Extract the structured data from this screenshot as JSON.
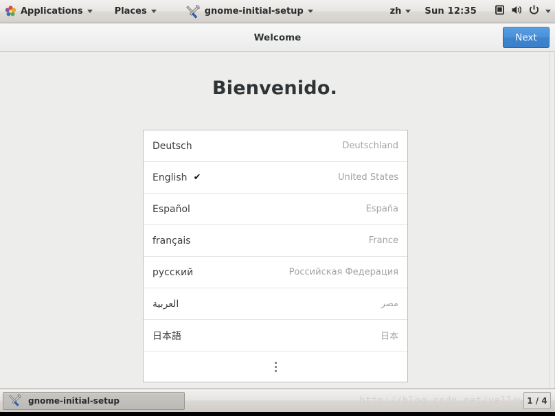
{
  "top_panel": {
    "applications_label": "Applications",
    "places_label": "Places",
    "window_menu_label": "gnome-initial-setup",
    "input_source_label": "zh",
    "clock_label": "Sun 12:35",
    "icons": {
      "applications": "fedora-pinwheel-icon",
      "window": "wrench-screwdriver-icon",
      "display": "display-icon",
      "volume": "speaker-icon",
      "power": "power-icon",
      "menu_arrow": "chevron-down-icon"
    }
  },
  "app_header": {
    "title": "Welcome",
    "next_label": "Next",
    "next_color": "#4a90d9"
  },
  "content": {
    "heading": "Bienvenido.",
    "languages": [
      {
        "name": "Deutsch",
        "region": "Deutschland",
        "selected": false,
        "rtl": false
      },
      {
        "name": "English",
        "region": "United States",
        "selected": true,
        "rtl": false
      },
      {
        "name": "Español",
        "region": "España",
        "selected": false,
        "rtl": false
      },
      {
        "name": "français",
        "region": "France",
        "selected": false,
        "rtl": false
      },
      {
        "name": "русский",
        "region": "Российская Федерация",
        "selected": false,
        "rtl": false
      },
      {
        "name": "العربية",
        "region": "مصر",
        "selected": false,
        "rtl": true
      },
      {
        "name": "日本語",
        "region": "日本",
        "selected": false,
        "rtl": false
      }
    ],
    "selected_check_glyph": "✔",
    "more_row_icon": "more-vertical-icon"
  },
  "taskbar": {
    "task_label": "gnome-initial-setup",
    "task_icon": "wrench-screwdriver-icon",
    "watermark": "http://blog.csdn.net/yellowcong",
    "workspace_label": "1 / 4"
  }
}
